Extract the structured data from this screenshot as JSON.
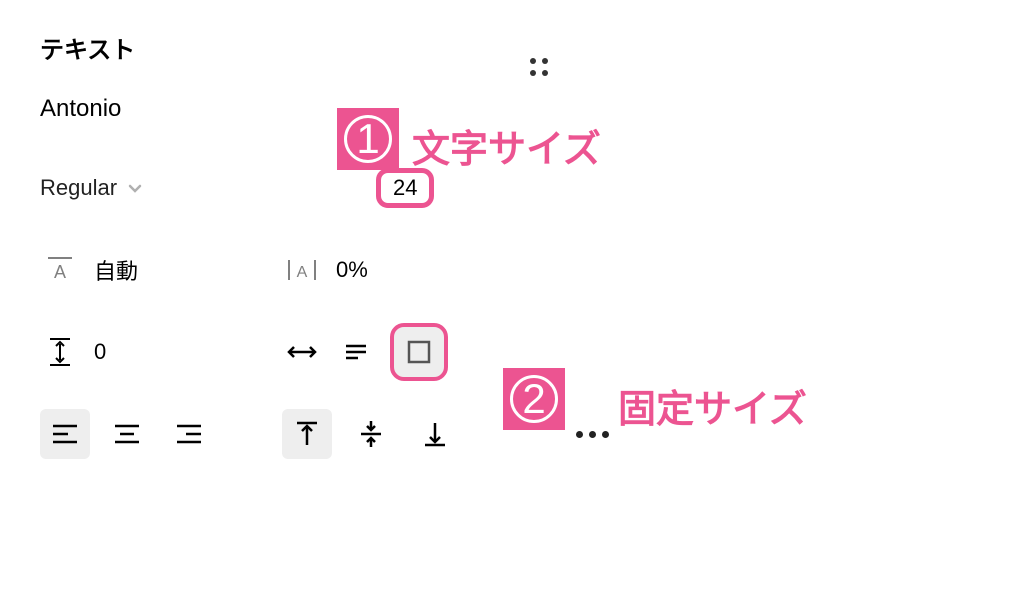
{
  "section": {
    "title": "テキスト"
  },
  "font": {
    "name": "Antonio",
    "weight": "Regular",
    "size": "24"
  },
  "lineHeight": {
    "value": "自動"
  },
  "letterSpacing": {
    "value": "0%"
  },
  "paragraphSpacing": {
    "value": "0"
  },
  "annotations": {
    "one": {
      "number": "1",
      "label": "文字サイズ"
    },
    "two": {
      "number": "2",
      "label": "固定サイズ"
    }
  }
}
